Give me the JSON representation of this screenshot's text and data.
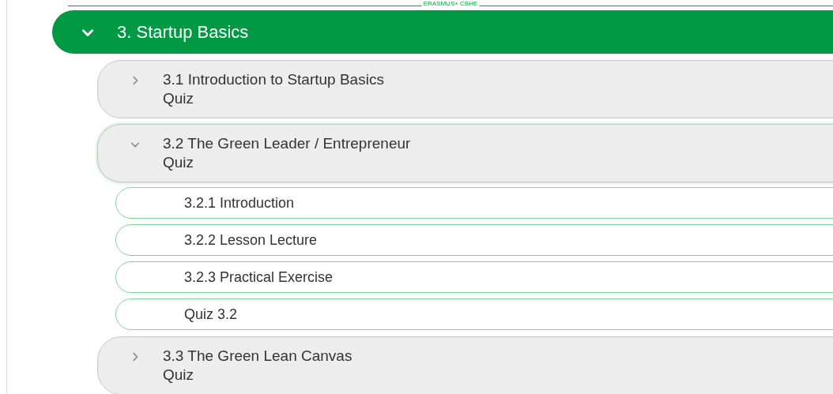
{
  "top_banner": {
    "text": "ERASMUS+ CBHE"
  },
  "section": {
    "title": "3. Startup Basics",
    "expanded": true,
    "subsections": [
      {
        "title": "3.1 Introduction to Startup Basics",
        "subtitle": "Quiz",
        "expanded": false
      },
      {
        "title": "3.2 The Green Leader / Entrepreneur",
        "subtitle": "Quiz",
        "expanded": true,
        "lessons": [
          {
            "title": "3.2.1 Introduction"
          },
          {
            "title": "3.2.2 Lesson Lecture"
          },
          {
            "title": "3.2.3 Practical Exercise"
          },
          {
            "title": "Quiz 3.2"
          }
        ]
      },
      {
        "title": "3.3 The Green Lean Canvas",
        "subtitle": "Quiz",
        "expanded": false
      }
    ]
  }
}
